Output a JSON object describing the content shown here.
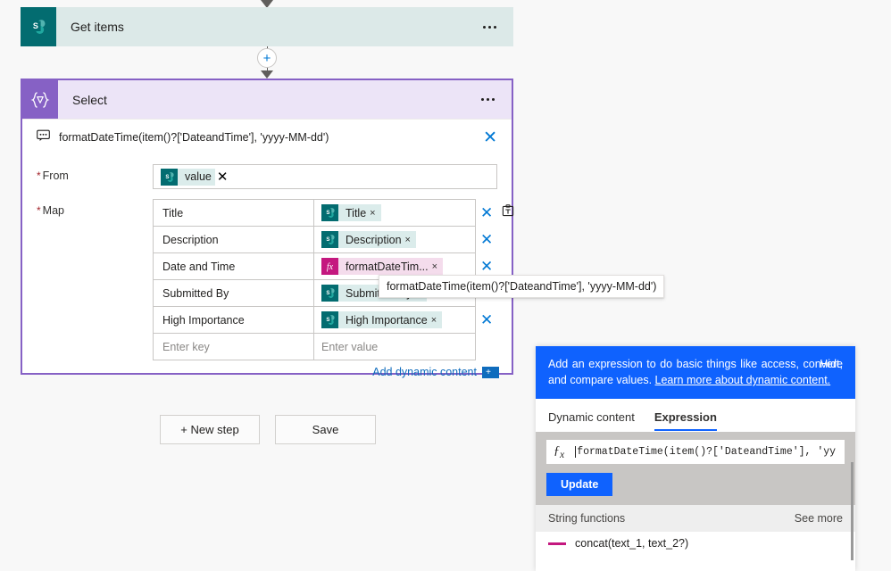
{
  "flow": {
    "steps": [
      {
        "id": "get-items",
        "title": "Get items",
        "icon": "sharepoint-icon",
        "menu": "more-options"
      },
      {
        "id": "select",
        "title": "Select",
        "icon": "select-curly-icon",
        "menu": "more-options"
      }
    ],
    "connector_add_label": "+"
  },
  "select_card": {
    "expression_summary": "formatDateTime(item()?['DateandTime'], 'yyyy-MM-dd')",
    "expression_close": "✕",
    "from": {
      "label": "From",
      "required_marker": "*",
      "token": {
        "icon": "sharepoint-icon",
        "label": "value",
        "remove": "✕"
      }
    },
    "map": {
      "label": "Map",
      "required_marker": "*",
      "rows": [
        {
          "key": "Title",
          "token_type": "sp",
          "token_icon": "sharepoint-icon",
          "token_label": "Title",
          "remove": "×",
          "actions": [
            "clear",
            "text-mode"
          ]
        },
        {
          "key": "Description",
          "token_type": "sp",
          "token_icon": "sharepoint-icon",
          "token_label": "Description",
          "remove": "×",
          "actions": [
            "clear"
          ]
        },
        {
          "key": "Date and Time",
          "token_type": "fx",
          "token_icon": "function-icon",
          "token_label": "formatDateTim...",
          "remove": "×",
          "actions": [
            "clear"
          ]
        },
        {
          "key": "Submitted By",
          "token_type": "sp",
          "token_icon": "sharepoint-icon",
          "token_label": "Submitted By",
          "remove": "×",
          "actions": [
            "clear"
          ]
        },
        {
          "key": "High Importance",
          "token_type": "sp",
          "token_icon": "sharepoint-icon",
          "token_label": "High Importance",
          "remove": "×",
          "actions": [
            "clear"
          ]
        }
      ],
      "placeholder_key": "Enter key",
      "placeholder_value": "Enter value"
    },
    "add_dynamic_content": "Add dynamic content"
  },
  "tooltip": {
    "text": "formatDateTime(item()?['DateandTime'], 'yyyy-MM-dd')"
  },
  "actions": {
    "new_step": "+ New step",
    "save": "Save"
  },
  "flyout": {
    "banner_text_1": "Add an expression to do basic things like access, convert, and compare values. ",
    "banner_link": "Learn more about dynamic content.",
    "hide": "Hide",
    "tabs": [
      {
        "label": "Dynamic content",
        "active": false
      },
      {
        "label": "Expression",
        "active": true
      }
    ],
    "expression_icon": "fx-icon",
    "expression_value": "formatDateTime(item()?['DateandTime'], 'yy",
    "update": "Update",
    "functions_group": "String functions",
    "see_more": "See more",
    "first_function": "concat(text_1, text_2?)"
  },
  "colors": {
    "sharepoint_teal": "#036c70",
    "select_purple": "#8661c5",
    "select_purple_light": "#ece4f7",
    "function_magenta": "#c4187f",
    "accent_blue": "#0f62fe",
    "link_blue": "#0078d4",
    "page_background": "#f8f8f8"
  }
}
